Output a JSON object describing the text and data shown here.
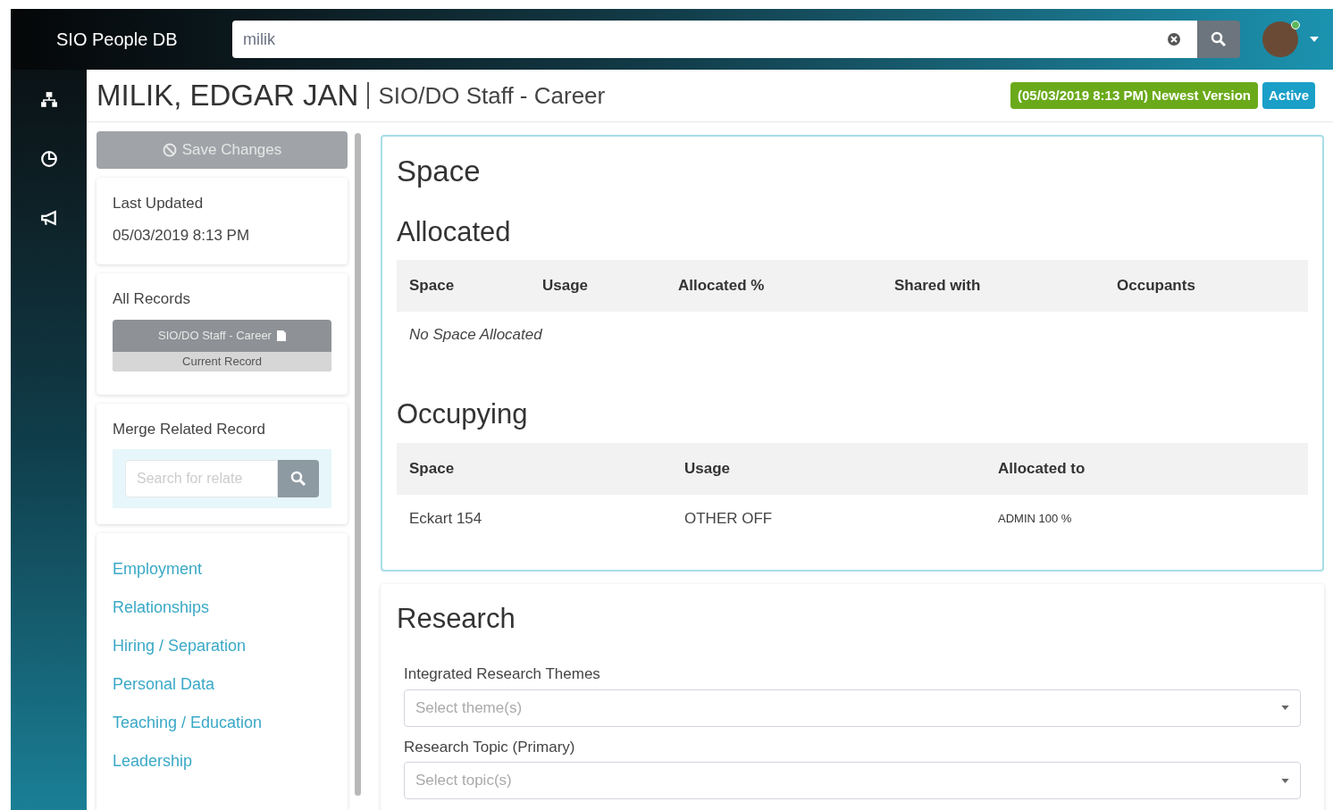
{
  "app": {
    "title": "SIO People DB"
  },
  "search": {
    "value": "milik"
  },
  "rail": [
    {
      "kind": "sitemap"
    },
    {
      "kind": "chart"
    },
    {
      "kind": "megaphone"
    }
  ],
  "header": {
    "name": "MILIK, EDGAR JAN",
    "record_type": "SIO/DO Staff - Career",
    "version_badge": "(05/03/2019 8:13 PM) Newest Version",
    "status_badge": "Active"
  },
  "sidebar": {
    "save_button": {
      "label": "Save Changes",
      "disabled": true
    },
    "last_updated": {
      "label": "Last Updated",
      "value": "05/03/2019 8:13 PM"
    },
    "records": {
      "label": "All Records",
      "items": [
        {
          "label": "SIO/DO Staff - Career",
          "caption": "Current Record",
          "selected": true
        }
      ]
    },
    "merge": {
      "label": "Merge Related Record",
      "placeholder": "Search for relate"
    },
    "nav": [
      "Employment",
      "Relationships",
      "Hiring / Separation",
      "Personal Data",
      "Teaching / Education",
      "Leadership"
    ]
  },
  "space": {
    "title": "Space",
    "allocated": {
      "title": "Allocated",
      "columns": [
        "Space",
        "Usage",
        "Allocated %",
        "Shared with",
        "Occupants"
      ],
      "empty": "No Space Allocated"
    },
    "occupying": {
      "title": "Occupying",
      "columns": [
        "Space",
        "Usage",
        "Allocated to"
      ],
      "rows": [
        [
          "Eckart 154",
          "OTHER OFF",
          "ADMIN 100 %"
        ]
      ]
    }
  },
  "research": {
    "title": "Research",
    "fields": [
      {
        "label": "Integrated Research Themes",
        "placeholder": "Select theme(s)"
      },
      {
        "label": "Research Topic (Primary)",
        "placeholder": "Select topic(s)"
      }
    ]
  }
}
